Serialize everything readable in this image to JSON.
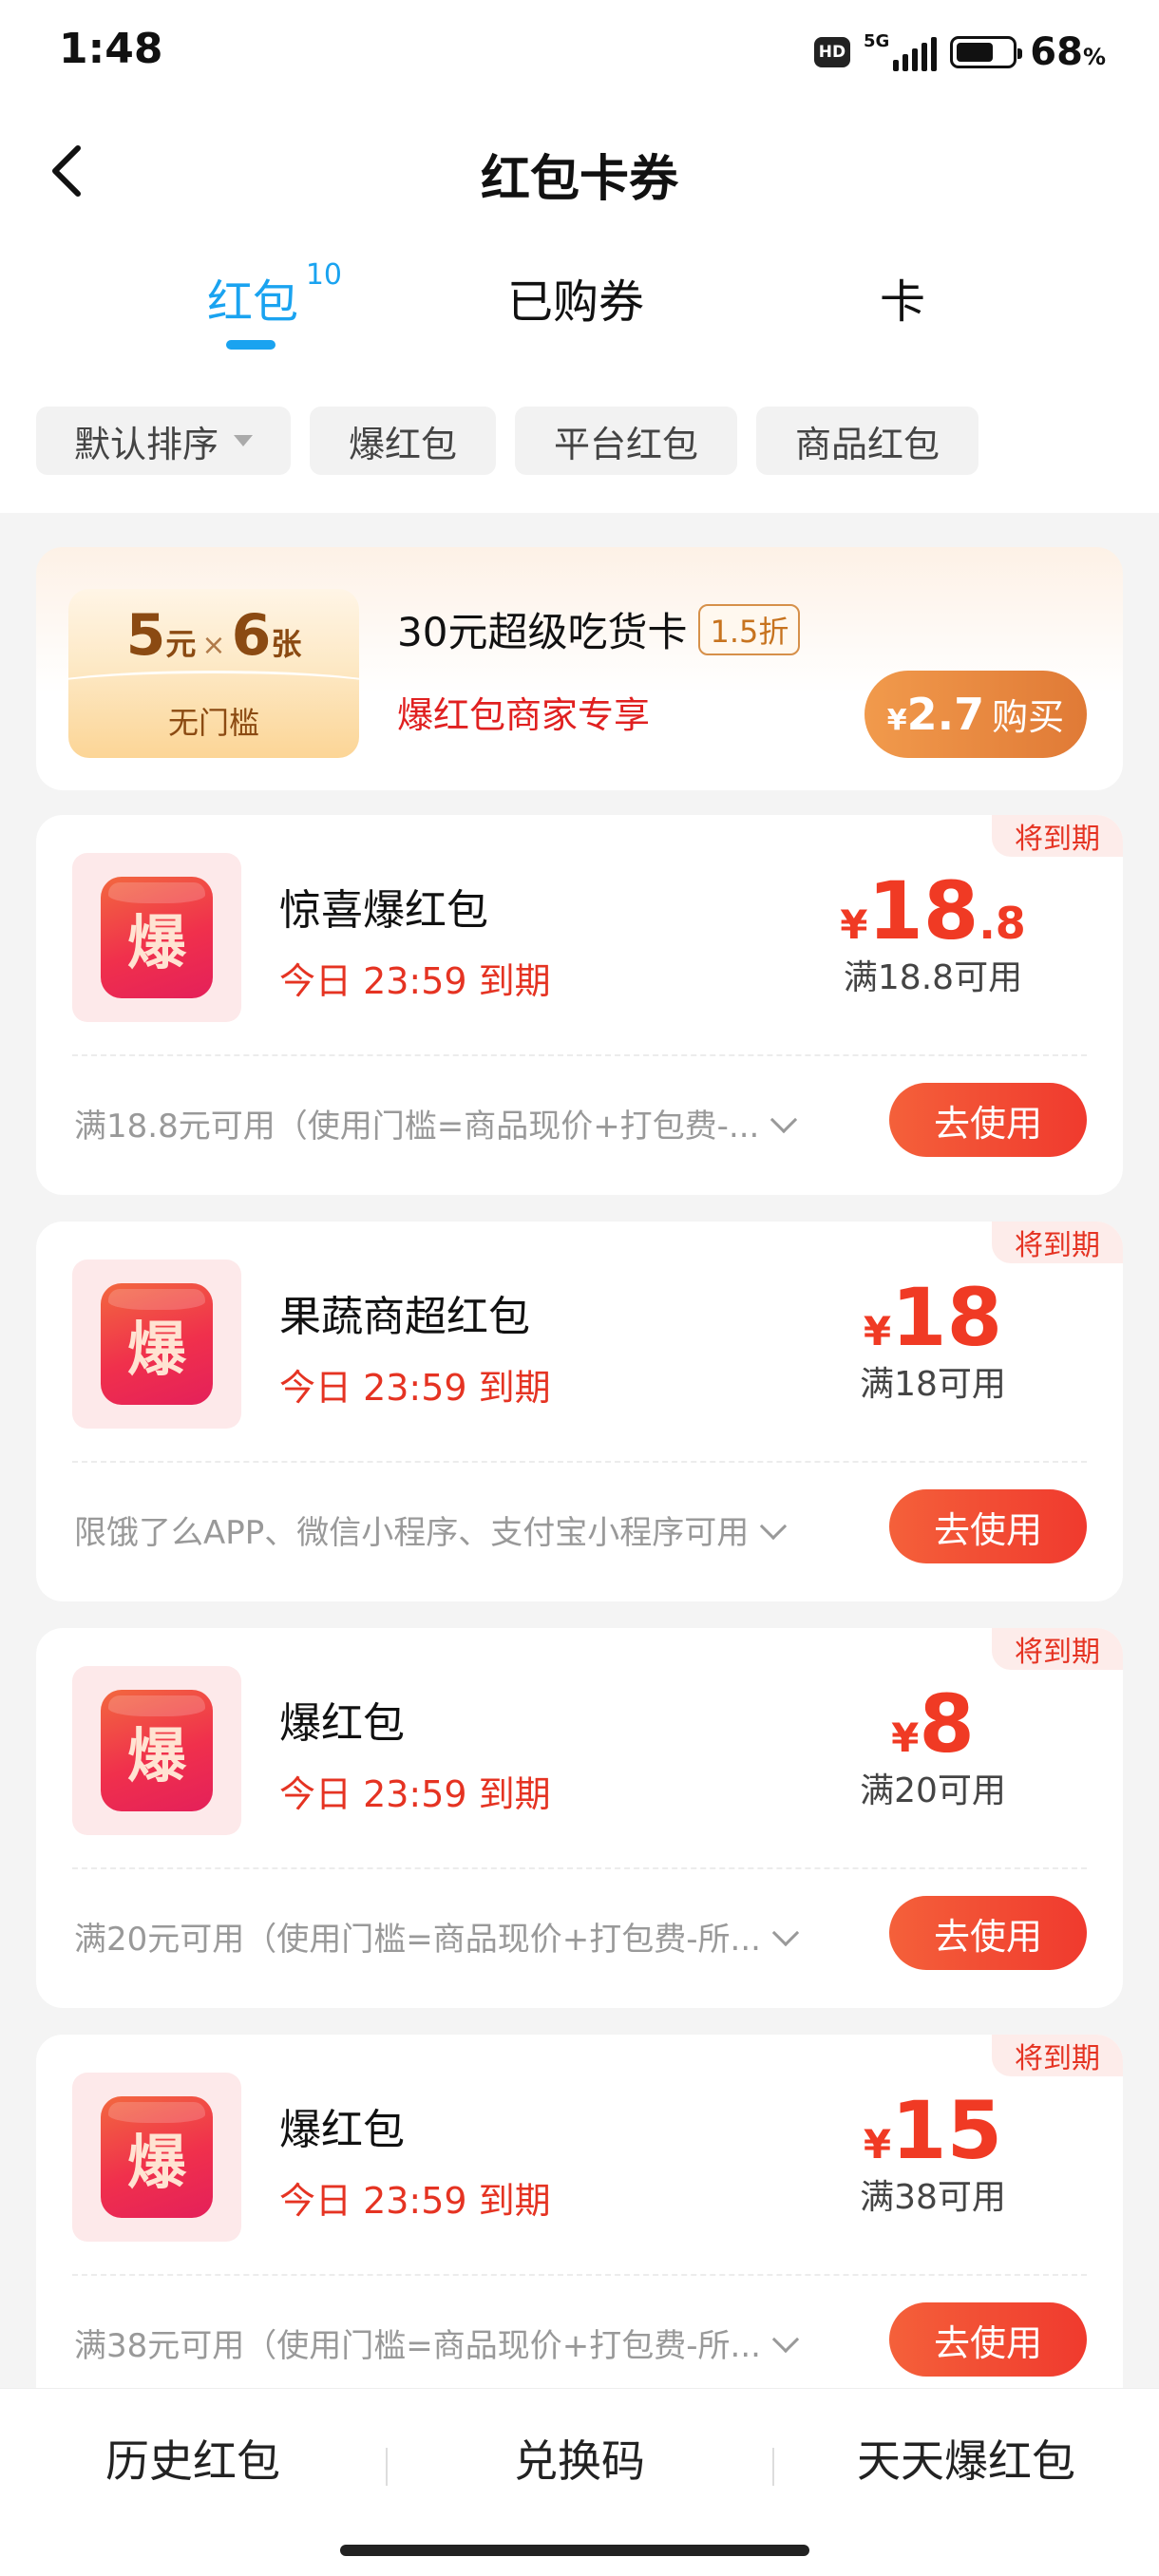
{
  "status": {
    "time": "1:48",
    "hd": "HD",
    "network": "5G",
    "battery_value": "68",
    "battery_unit": "%",
    "battery_level": 0.68
  },
  "nav": {
    "title": "红包卡券"
  },
  "tabs": [
    {
      "label": "红包",
      "count": "10"
    },
    {
      "label": "已购券"
    },
    {
      "label": "卡"
    }
  ],
  "filters": [
    "默认排序",
    "爆红包",
    "平台红包",
    "商品红包"
  ],
  "promo": {
    "amount": "5",
    "amount_unit": "元",
    "times": "×",
    "qty": "6",
    "qty_unit": "张",
    "ticket_sub": "无门槛",
    "title": "30元超级吃货卡",
    "discount": "1.5折",
    "subtitle": "爆红包商家专享",
    "buy_yen": "¥",
    "buy_price": "2.7",
    "buy_label": "购买"
  },
  "coupons": [
    {
      "tag": "将到期",
      "icon_char": "爆",
      "title": "惊喜爆红包",
      "expiry": "今日 23:59 到期",
      "yen": "¥",
      "amount_int": "18",
      "amount_dec": ".8",
      "threshold": "满18.8可用",
      "note": "满18.8元可用（使用门槛=商品现价+打包费-...",
      "button": "去使用"
    },
    {
      "tag": "将到期",
      "icon_char": "爆",
      "title": "果蔬商超红包",
      "expiry": "今日 23:59 到期",
      "yen": "¥",
      "amount_int": "18",
      "amount_dec": "",
      "threshold": "满18可用",
      "note": "限饿了么APP、微信小程序、支付宝小程序可用",
      "button": "去使用"
    },
    {
      "tag": "将到期",
      "icon_char": "爆",
      "title": "爆红包",
      "expiry": "今日 23:59 到期",
      "yen": "¥",
      "amount_int": "8",
      "amount_dec": "",
      "threshold": "满20可用",
      "note": "满20元可用（使用门槛=商品现价+打包费-所...",
      "button": "去使用"
    },
    {
      "tag": "将到期",
      "icon_char": "爆",
      "title": "爆红包",
      "expiry": "今日 23:59 到期",
      "yen": "¥",
      "amount_int": "15",
      "amount_dec": "",
      "threshold": "满38可用",
      "note": "满38元可用（使用门槛=商品现价+打包费-所...",
      "button": "去使用"
    }
  ],
  "bottom": [
    "历史红包",
    "兑换码",
    "天天爆红包"
  ]
}
